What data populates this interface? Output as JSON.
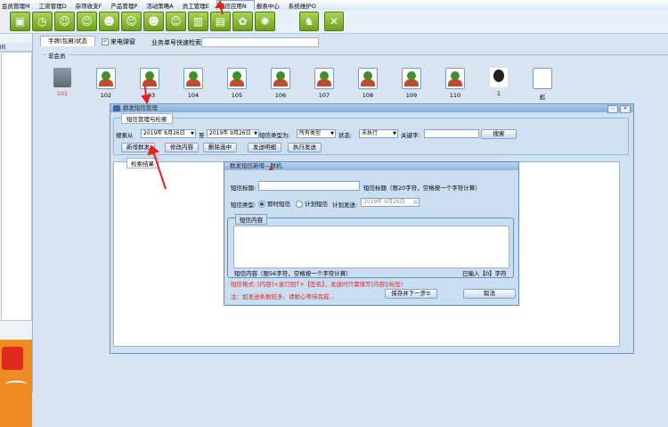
{
  "menu": [
    "会员管理M",
    "工资管理D",
    "杂项收支F",
    "产品管理P",
    "活动策略A",
    "员工管理E",
    "短信应用N",
    "报表中心",
    "系统维护O"
  ],
  "toolbar_icons": [
    "dice-icon",
    "clock-icon",
    "user-add-icon",
    "user-add-icon",
    "user-group-icon",
    "user-check-icon",
    "user-icon",
    "user-add-icon",
    "book-icon",
    "save-icon",
    "gear-icon",
    "gear-icon",
    "key-icon",
    "close-icon"
  ],
  "tab": {
    "label": "手牌(包厢)状态"
  },
  "no_popup": {
    "label": "来电弹窗",
    "checked": "✓"
  },
  "quick_search": {
    "label": "业务单号快速检索："
  },
  "room_frame": {
    "legend": "非会员"
  },
  "rooms": [
    {
      "label": "101",
      "kind": "folder",
      "color": "#c0392b"
    },
    {
      "label": "102",
      "kind": "person"
    },
    {
      "label": "103",
      "kind": "person"
    },
    {
      "label": "104",
      "kind": "person"
    },
    {
      "label": "105",
      "kind": "person"
    },
    {
      "label": "106",
      "kind": "person"
    },
    {
      "label": "107",
      "kind": "person"
    },
    {
      "label": "108",
      "kind": "person"
    },
    {
      "label": "109",
      "kind": "person"
    },
    {
      "label": "110",
      "kind": "person"
    },
    {
      "label": "1",
      "kind": "dark"
    },
    {
      "label": "彪",
      "kind": "plain"
    }
  ],
  "dialog": {
    "title": "群发短信管理",
    "group_title": "短信管理与检索",
    "search_from": "搜索从",
    "date_from": "2019年 8月26日",
    "to": "至",
    "date_to": "2019年 9月26日",
    "type_label": "短信类型为:",
    "type_value": "所有类型",
    "status_label": "状态:",
    "status_value": "未执行",
    "keyword_label": "关键字:",
    "search_btn": "搜索",
    "buttons": [
      "新增群发",
      "修改内容",
      "删除选中",
      "发送明细",
      "执行发送"
    ],
    "result_title": "检索结果"
  },
  "sub": {
    "title": "群发短信新增—联机",
    "sms_title_label": "短信标题:",
    "sms_title_hint": "短信标题（限20字符，空格按一个字符计算）",
    "sms_type_label": "短信类型:",
    "radio_now": "即时短信",
    "radio_plan": "计划短信",
    "plan_send_label": "计划发送:",
    "plan_date": "2019年 9月26日",
    "content_title": "短信内容",
    "content_hint": "短信内容（限56字符，空格按一个字符计算）",
    "content_count": "已输入【0】字符",
    "format_note": "短信格式: [内容]+退订回T+【签名】，发送时只需填写[内容]|标签!",
    "warn_note": "注：如发送条数较多，请耐心等待完成...",
    "save_btn": "保存并下一步≡",
    "cancel_btn": "取消"
  }
}
